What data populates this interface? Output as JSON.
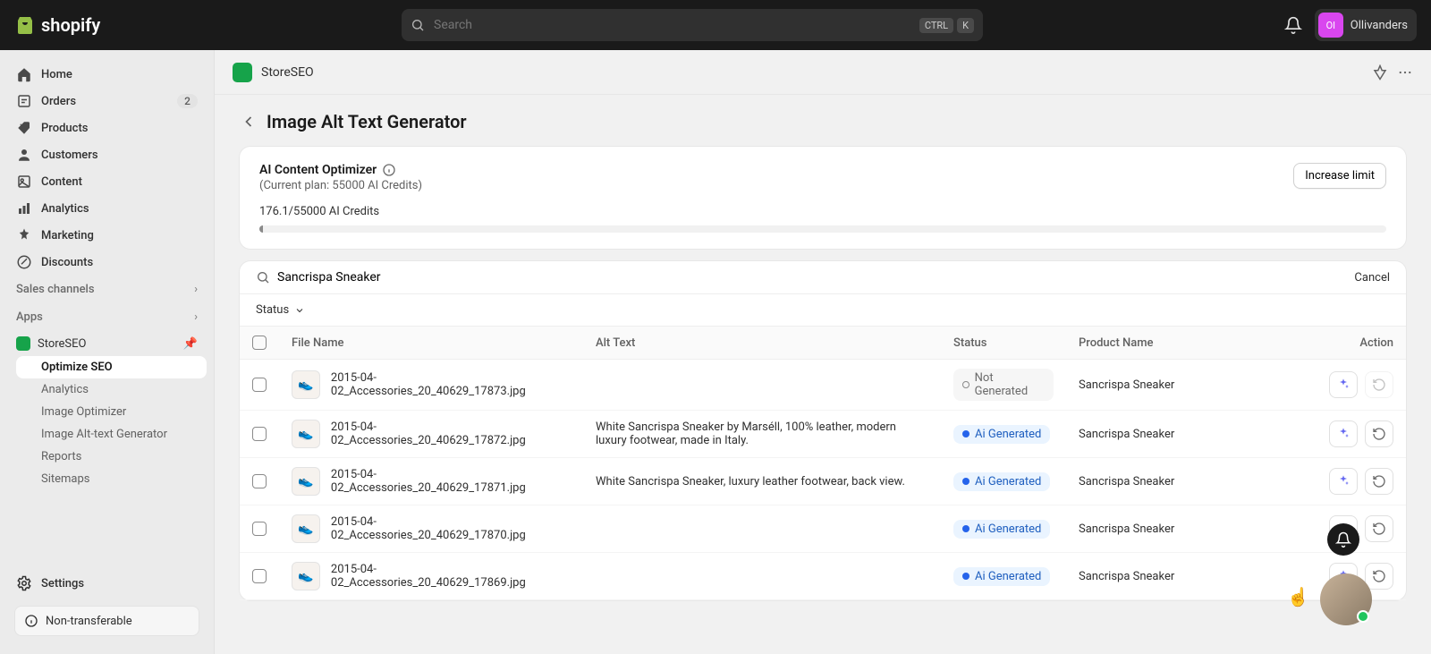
{
  "brand": "shopify",
  "search": {
    "placeholder": "Search",
    "ctrl": "CTRL",
    "k": "K"
  },
  "user": {
    "initials": "Ol",
    "name": "Ollivanders"
  },
  "nav": {
    "home": "Home",
    "orders": "Orders",
    "orders_badge": "2",
    "products": "Products",
    "customers": "Customers",
    "content": "Content",
    "analytics": "Analytics",
    "marketing": "Marketing",
    "discounts": "Discounts",
    "sales_channels": "Sales channels",
    "apps": "Apps"
  },
  "app_nav": {
    "storeseo": "StoreSEO",
    "optimize": "Optimize SEO",
    "analytics": "Analytics",
    "image_opt": "Image Optimizer",
    "alt_gen": "Image Alt-text Generator",
    "reports": "Reports",
    "sitemaps": "Sitemaps"
  },
  "settings": "Settings",
  "non_transferable": "Non-transferable",
  "app_header": {
    "name": "StoreSEO"
  },
  "page": {
    "title": "Image Alt Text Generator"
  },
  "optimizer": {
    "title": "AI Content Optimizer",
    "subtitle": "(Current plan: 55000 AI Credits)",
    "credits": "176.1/55000 AI Credits",
    "increase": "Increase limit"
  },
  "table": {
    "search_value": "Sancrispa Sneaker",
    "cancel": "Cancel",
    "status_filter": "Status",
    "headers": {
      "file": "File Name",
      "alt": "Alt Text",
      "status": "Status",
      "product": "Product Name",
      "action": "Action"
    },
    "rows": [
      {
        "file": "2015-04-02_Accessories_20_40629_17873.jpg",
        "alt": "",
        "status": "Not Generated",
        "status_type": "not",
        "product": "Sancrispa Sneaker",
        "undo": false
      },
      {
        "file": "2015-04-02_Accessories_20_40629_17872.jpg",
        "alt": "White Sancrispa Sneaker by Marséll, 100% leather, modern luxury footwear, made in Italy.",
        "status": "Ai Generated",
        "status_type": "ai",
        "product": "Sancrispa Sneaker",
        "undo": true
      },
      {
        "file": "2015-04-02_Accessories_20_40629_17871.jpg",
        "alt": "White Sancrispa Sneaker, luxury leather footwear, back view.",
        "status": "Ai Generated",
        "status_type": "ai",
        "product": "Sancrispa Sneaker",
        "undo": true
      },
      {
        "file": "2015-04-02_Accessories_20_40629_17870.jpg",
        "alt": "",
        "status": "Ai Generated",
        "status_type": "ai",
        "product": "Sancrispa Sneaker",
        "undo": true
      },
      {
        "file": "2015-04-02_Accessories_20_40629_17869.jpg",
        "alt": "",
        "status": "Ai Generated",
        "status_type": "ai",
        "product": "Sancrispa Sneaker",
        "undo": true
      }
    ]
  }
}
